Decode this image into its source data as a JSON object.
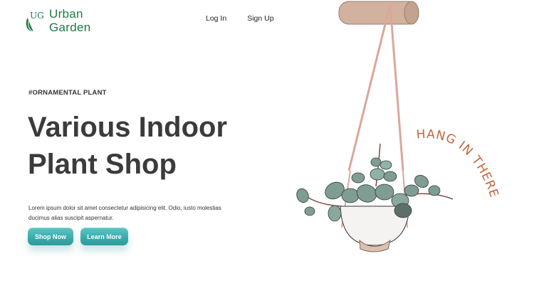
{
  "brand": {
    "monogram": "UG",
    "name_line1": "Urban",
    "name_line2": "Garden",
    "color": "#1e7a43"
  },
  "nav": {
    "login": "Log In",
    "signup": "Sign Up"
  },
  "hero": {
    "tag": "#ORNAMENTAL PLANT",
    "title_line1": "Various Indoor",
    "title_line2": "Plant Shop",
    "description": "Lorem ipsum dolor sit amet consectetur adipisicing elit. Odio, iusto molestias ducimus alias suscipit aspernatur."
  },
  "buttons": {
    "shop": "Shop Now",
    "learn": "Learn More",
    "accent": "#3aa9aa"
  },
  "illustration": {
    "caption": "HANG IN THERE",
    "caption_color": "#c4643f"
  }
}
